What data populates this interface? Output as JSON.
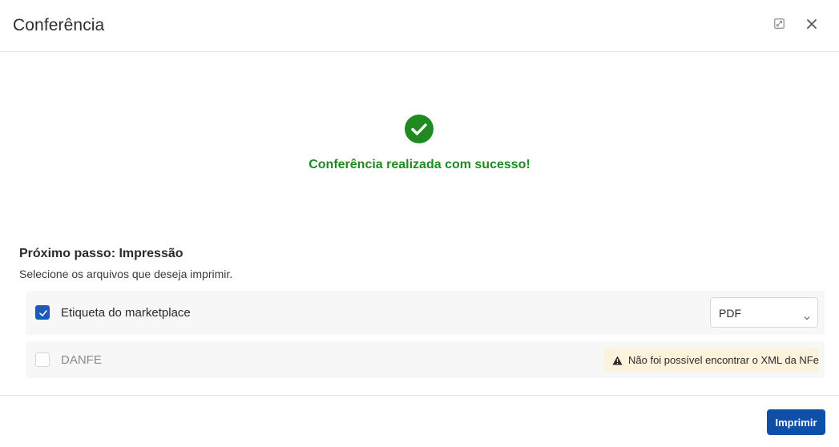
{
  "dialog": {
    "title": "Conferência",
    "expand_icon": "expand-icon",
    "close_icon": "close-icon"
  },
  "success": {
    "icon": "check-circle-icon",
    "message": "Conferência realizada com sucesso!",
    "color": "#1f8a1f"
  },
  "next_step": {
    "title": "Próximo passo: Impressão",
    "subtitle": "Selecione os arquivos que deseja imprimir."
  },
  "files": [
    {
      "label": "Etiqueta do marketplace",
      "checked": true,
      "format": "PDF"
    },
    {
      "label": "DANFE",
      "checked": false,
      "warning": "Não foi possível encontrar o XML da NFe",
      "warning_icon": "warning-icon"
    }
  ],
  "footer": {
    "print_label": "Imprimir",
    "accent": "#0f4fa8"
  }
}
